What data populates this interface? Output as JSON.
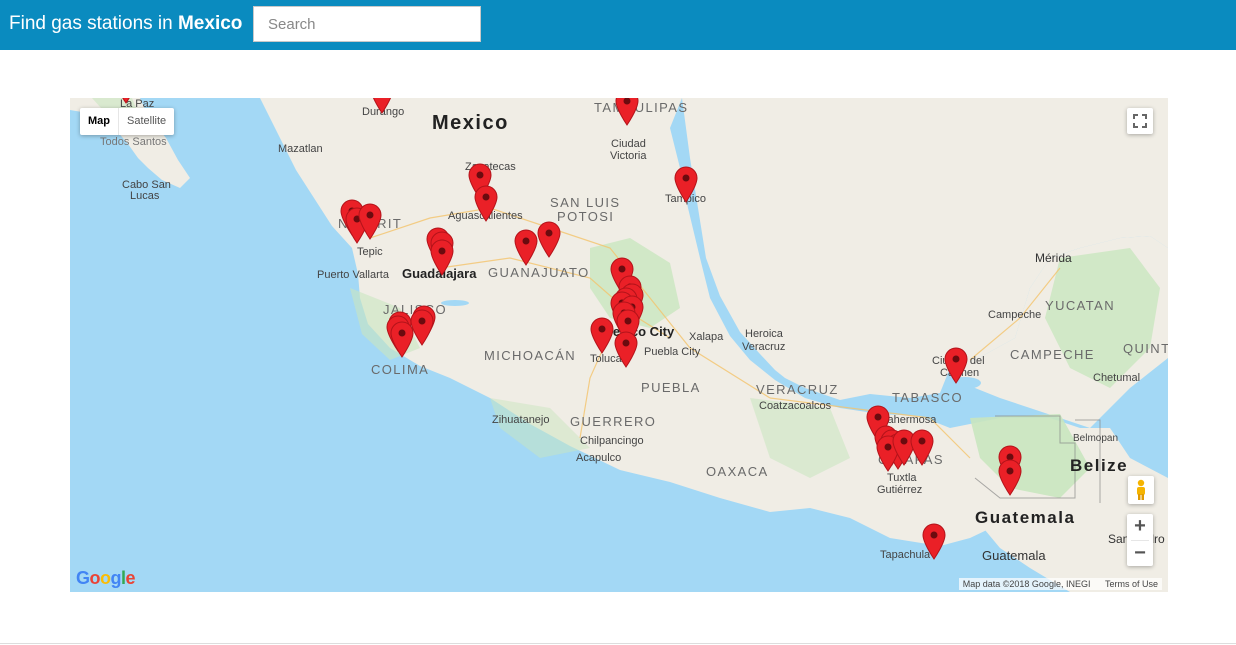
{
  "header": {
    "title_prefix": "Find gas stations in",
    "title_country": "Mexico",
    "search_placeholder": "Search"
  },
  "map": {
    "type_control": {
      "map_label": "Map",
      "satellite_label": "Satellite",
      "selected": "Map"
    },
    "attribution": {
      "data": "Map data ©2018 Google, INEGI",
      "terms": "Terms of Use"
    },
    "logo": [
      "G",
      "o",
      "o",
      "g",
      "l",
      "e"
    ],
    "zoom_in_label": "+",
    "zoom_out_label": "−",
    "icons": {
      "fullscreen": "fullscreen-icon",
      "pegman": "pegman-icon",
      "marker": "map-marker-icon"
    },
    "colors": {
      "water": "#a3d8f5",
      "land": "#f0ede5",
      "vegetation": "#c9e6bf",
      "marker": "#ea2027",
      "header": "#0a8bbf"
    },
    "labels": [
      {
        "text": "Mexico",
        "kind": "country"
      },
      {
        "text": "TAMAULIPAS",
        "kind": "state"
      },
      {
        "text": "Durango",
        "kind": "city"
      },
      {
        "text": "La Paz",
        "kind": "city"
      },
      {
        "text": "Todos Santos",
        "kind": "city"
      },
      {
        "text": "Cabo San",
        "kind": "city"
      },
      {
        "text": "Lucas",
        "kind": "city"
      },
      {
        "text": "Mazatlan",
        "kind": "city"
      },
      {
        "text": "Ciudad",
        "kind": "city"
      },
      {
        "text": "Victoria",
        "kind": "city"
      },
      {
        "text": "Zacatecas",
        "kind": "city"
      },
      {
        "text": "Aguascalientes",
        "kind": "city"
      },
      {
        "text": "SAN LUIS",
        "kind": "state"
      },
      {
        "text": "POTOSI",
        "kind": "state"
      },
      {
        "text": "Tampico",
        "kind": "city"
      },
      {
        "text": "NAYARIT",
        "kind": "state"
      },
      {
        "text": "Tepic",
        "kind": "city"
      },
      {
        "text": "Puerto Vallarta",
        "kind": "city"
      },
      {
        "text": "Guadalajara",
        "kind": "big"
      },
      {
        "text": "GUANAJUATO",
        "kind": "state"
      },
      {
        "text": "JALISCO",
        "kind": "state"
      },
      {
        "text": "Mexico City",
        "kind": "big"
      },
      {
        "text": "Xalapa",
        "kind": "city"
      },
      {
        "text": "Heroica",
        "kind": "city"
      },
      {
        "text": "Veracruz",
        "kind": "city"
      },
      {
        "text": "MICHOACÁN",
        "kind": "state"
      },
      {
        "text": "Toluca",
        "kind": "city"
      },
      {
        "text": "Puebla City",
        "kind": "city"
      },
      {
        "text": "COLIMA",
        "kind": "state"
      },
      {
        "text": "PUEBLA",
        "kind": "state"
      },
      {
        "text": "VERACRUZ",
        "kind": "state"
      },
      {
        "text": "Mérida",
        "kind": "city"
      },
      {
        "text": "YUCATAN",
        "kind": "state"
      },
      {
        "text": "Campeche",
        "kind": "city"
      },
      {
        "text": "Ciudad del",
        "kind": "city"
      },
      {
        "text": "Carmen",
        "kind": "city"
      },
      {
        "text": "CAMPECHE",
        "kind": "state"
      },
      {
        "text": "QUINT",
        "kind": "state"
      },
      {
        "text": "Chetumal",
        "kind": "city"
      },
      {
        "text": "TABASCO",
        "kind": "state"
      },
      {
        "text": "Villahermosa",
        "kind": "city"
      },
      {
        "text": "Coatzacoalcos",
        "kind": "city"
      },
      {
        "text": "Zihuatanejo",
        "kind": "city"
      },
      {
        "text": "GUERRERO",
        "kind": "state"
      },
      {
        "text": "Chilpancingo",
        "kind": "city"
      },
      {
        "text": "Acapulco",
        "kind": "city"
      },
      {
        "text": "OAXACA",
        "kind": "state"
      },
      {
        "text": "CHIAPAS",
        "kind": "state"
      },
      {
        "text": "Tuxtla",
        "kind": "city"
      },
      {
        "text": "Gutiérrez",
        "kind": "city"
      },
      {
        "text": "Belmopan",
        "kind": "city"
      },
      {
        "text": "Belize",
        "kind": "country"
      },
      {
        "text": "Guatemala",
        "kind": "country"
      },
      {
        "text": "Guatemala",
        "kind": "city"
      },
      {
        "text": "Tapachula",
        "kind": "city"
      },
      {
        "text": "San Pedro",
        "kind": "city"
      }
    ]
  }
}
